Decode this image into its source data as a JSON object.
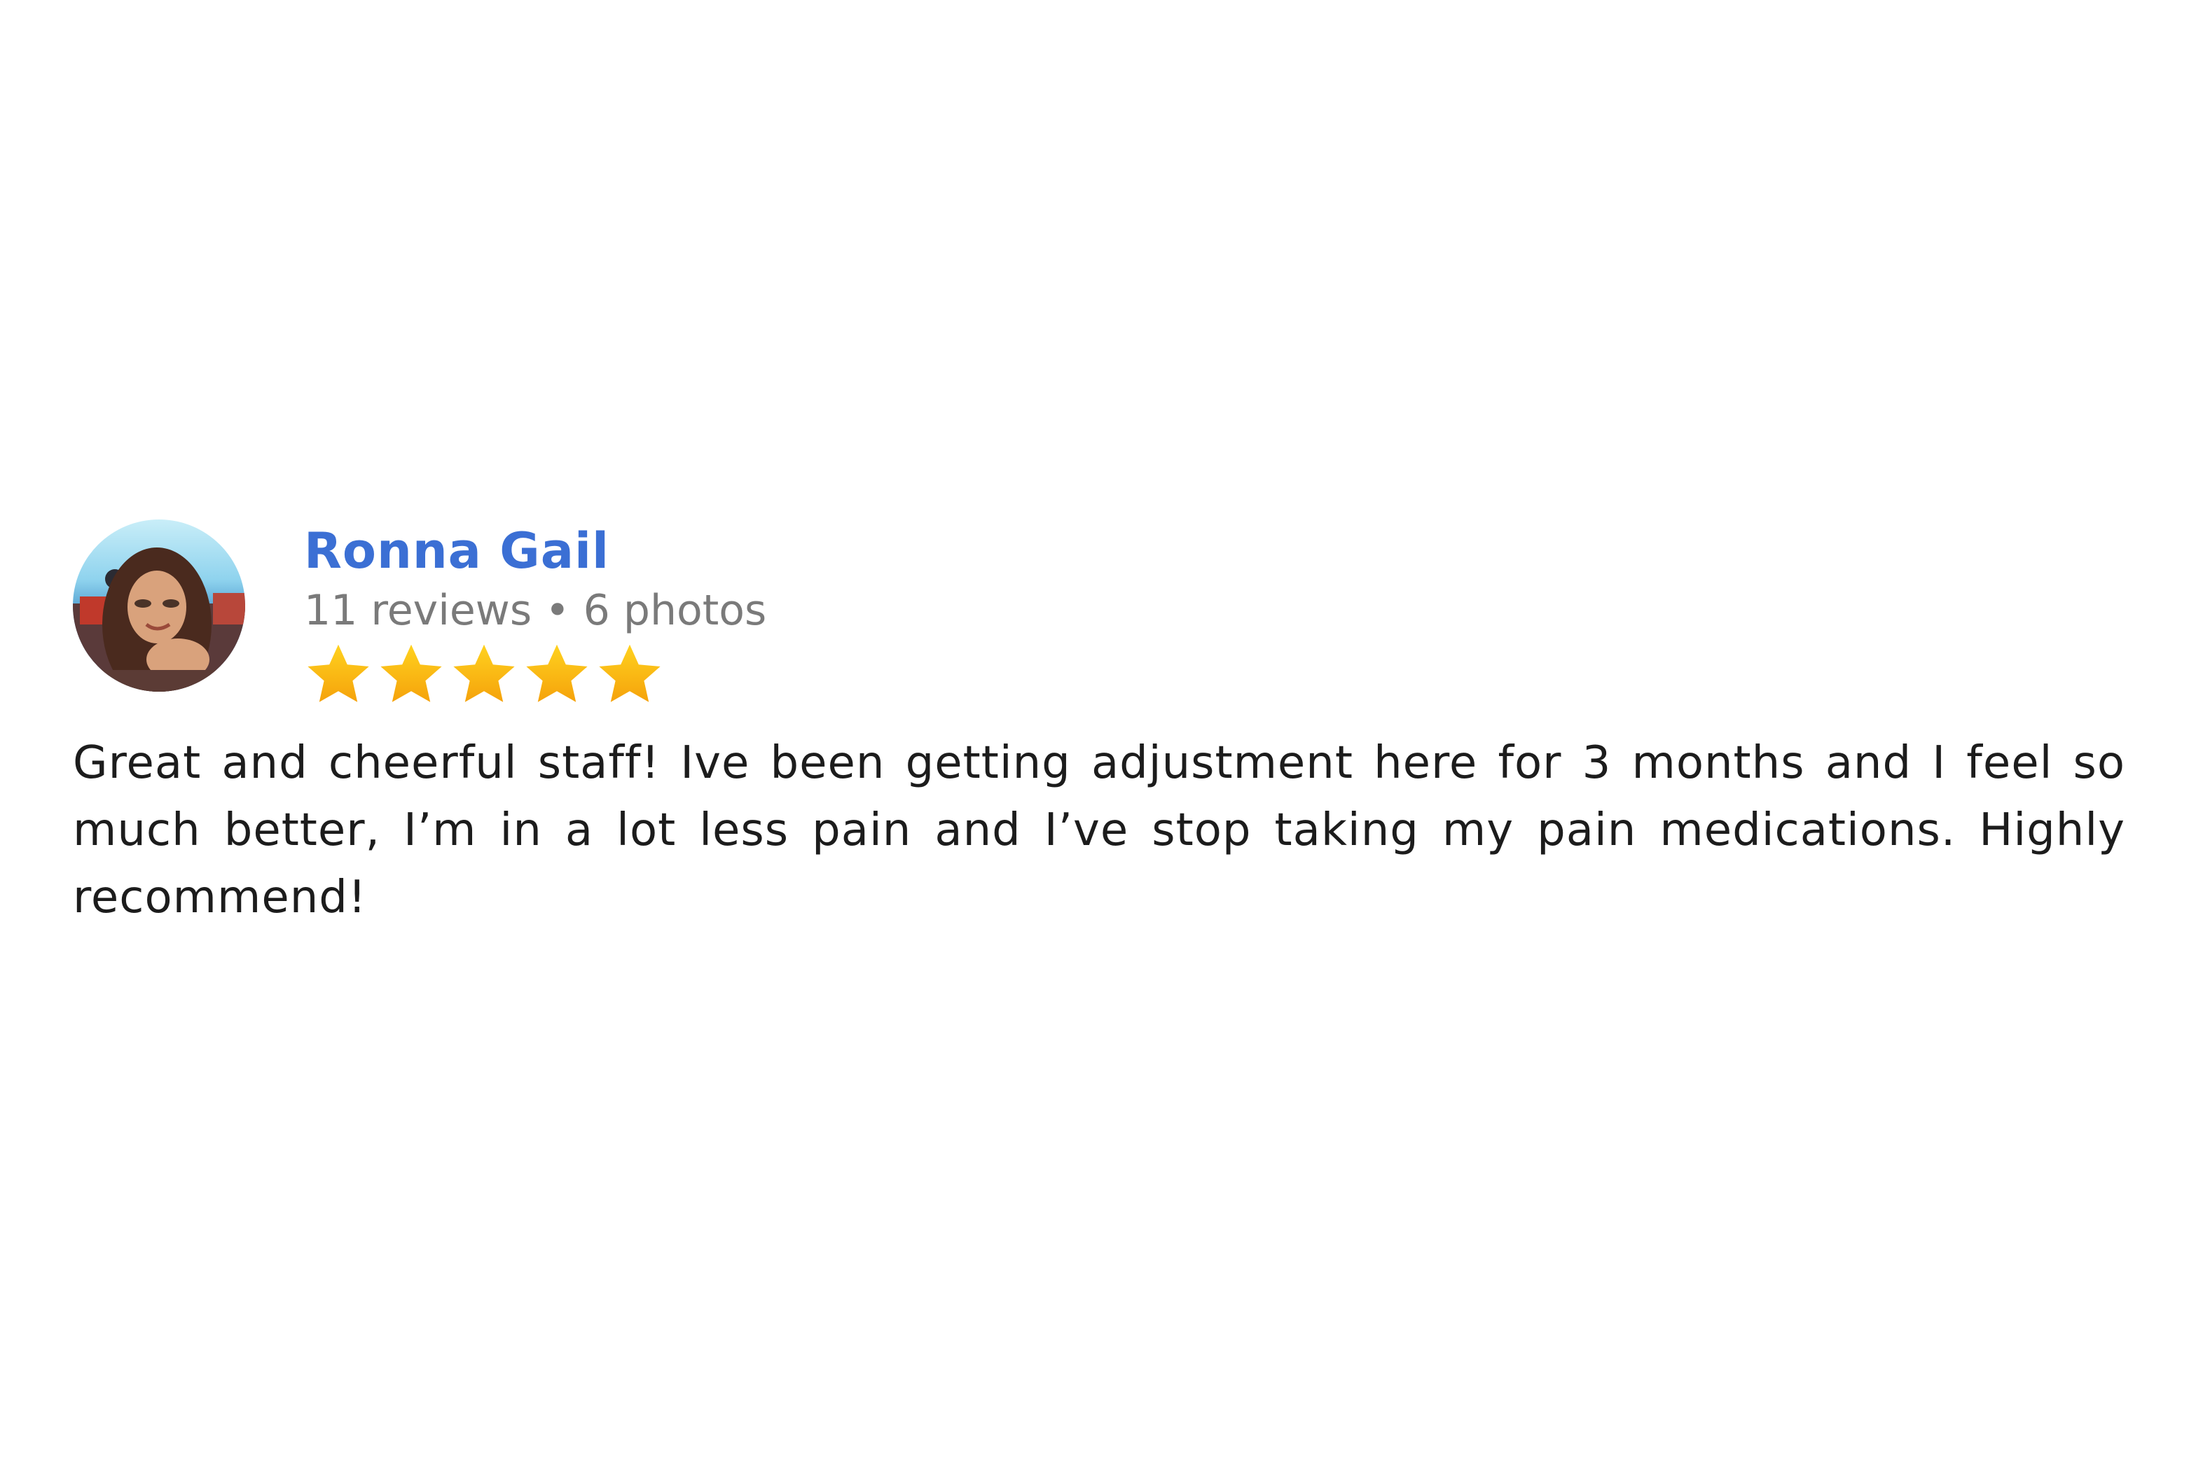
{
  "review": {
    "reviewer": {
      "name": "Ronna Gail",
      "stats": "11 reviews • 6 photos",
      "avatar_icon": "profile-photo"
    },
    "rating": 5,
    "rating_max": 5,
    "star_color": "#fbbc05",
    "name_color": "#3b6fd4",
    "text": "Great and cheerful staff! Ive been getting adjustment here for 3 months and I feel so much better, I’m in a lot less pain and I’ve stop taking my pain medications. Highly recommend!"
  }
}
